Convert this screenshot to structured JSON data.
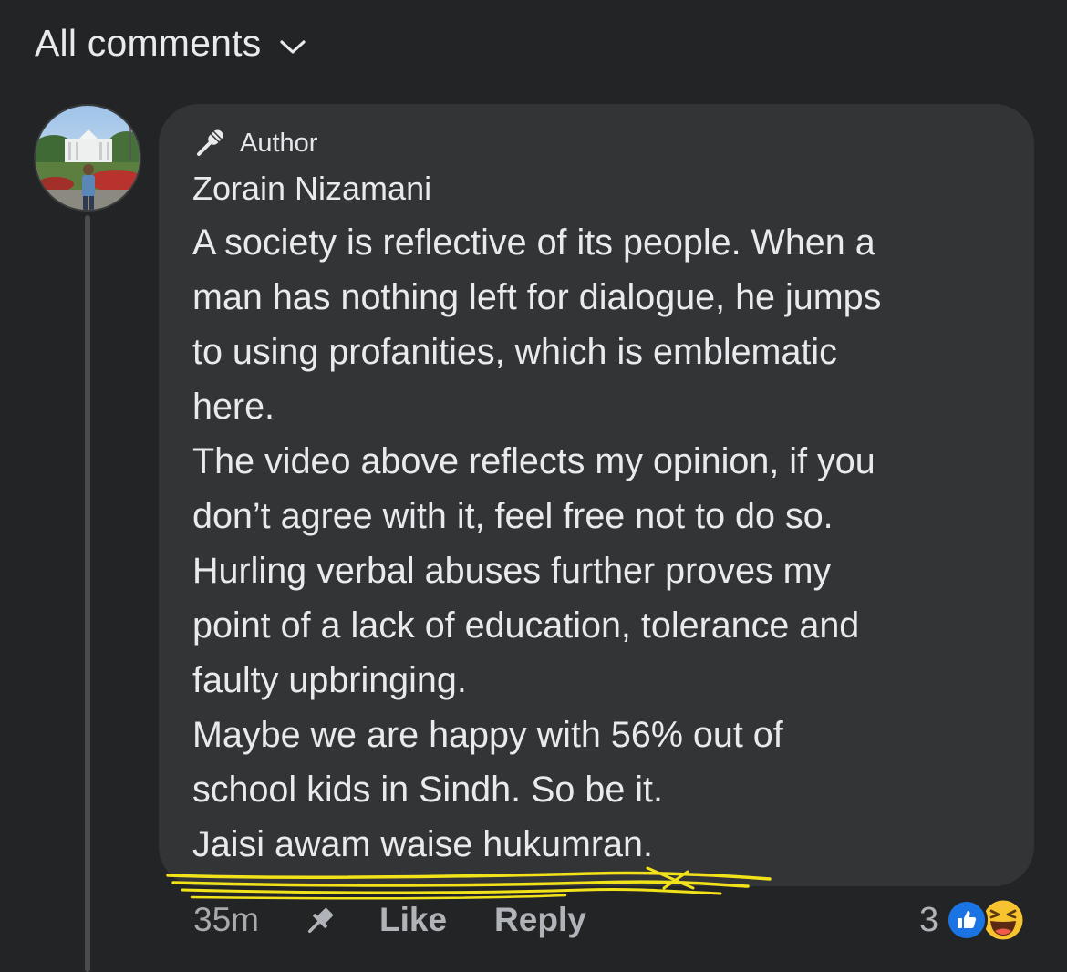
{
  "header": {
    "title": "All comments"
  },
  "comment": {
    "badge_label": "Author",
    "author_name": "Zorain Nizamani",
    "lines": [
      "A society is reflective of its people. When a",
      "man has nothing left for dialogue, he jumps",
      "to using profanities, which is emblematic",
      "here.",
      "The video above reflects my opinion, if you",
      "don’t agree with it, feel free not to do so.",
      "Hurling verbal abuses further proves my",
      "point of a lack of education, tolerance and",
      "faulty upbringing.",
      "Maybe we are happy with 56% out of",
      "school kids in Sindh. So be it.",
      "Jaisi awam waise hukumran."
    ],
    "timestamp": "35m",
    "like_label": "Like",
    "reply_label": "Reply",
    "reaction_count": "3",
    "reactions": [
      "like-icon",
      "haha-icon"
    ]
  },
  "colors": {
    "background": "#232425",
    "bubble": "#323436",
    "text": "#e9eaed",
    "muted": "#a8aaae",
    "like_blue": "#1b74e4",
    "highlight_yellow": "#f2e21a"
  }
}
